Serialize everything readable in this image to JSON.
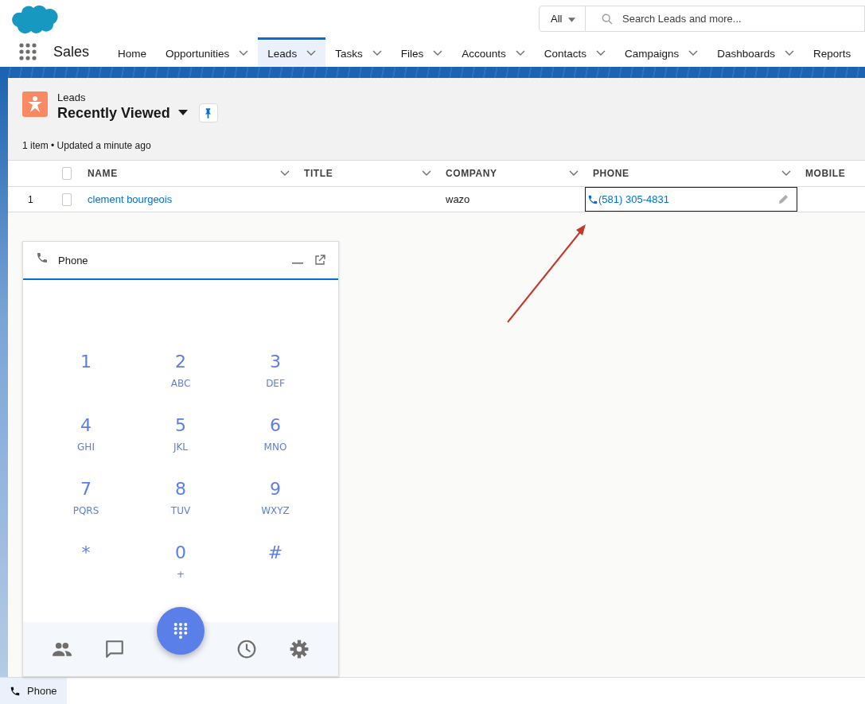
{
  "app": {
    "name": "Sales"
  },
  "search": {
    "scope": "All",
    "placeholder": "Search Leads and more..."
  },
  "nav": [
    {
      "label": "Home",
      "selected": false,
      "menu": false
    },
    {
      "label": "Opportunities",
      "selected": false,
      "menu": true
    },
    {
      "label": "Leads",
      "selected": true,
      "menu": true
    },
    {
      "label": "Tasks",
      "selected": false,
      "menu": true
    },
    {
      "label": "Files",
      "selected": false,
      "menu": true
    },
    {
      "label": "Accounts",
      "selected": false,
      "menu": true
    },
    {
      "label": "Contacts",
      "selected": false,
      "menu": true
    },
    {
      "label": "Campaigns",
      "selected": false,
      "menu": true
    },
    {
      "label": "Dashboards",
      "selected": false,
      "menu": true
    },
    {
      "label": "Reports",
      "selected": false,
      "menu": false
    }
  ],
  "list": {
    "object": "Leads",
    "view": "Recently Viewed",
    "status": "1 item • Updated a minute ago"
  },
  "table": {
    "all_checked": false,
    "columns": [
      {
        "label": "NAME",
        "menu": true
      },
      {
        "label": "TITLE",
        "menu": true
      },
      {
        "label": "COMPANY",
        "menu": true
      },
      {
        "label": "PHONE",
        "menu": true
      },
      {
        "label": "MOBILE"
      }
    ],
    "rows": [
      {
        "number": "1",
        "checked": false,
        "name": "clement bourgeois",
        "company": "wazo",
        "phone": "(581) 305-4831",
        "focused": true
      }
    ]
  },
  "phone_panel": {
    "title": "Phone",
    "keys": [
      {
        "digit": "1"
      },
      {
        "digit": "2",
        "letters": "ABC"
      },
      {
        "digit": "3",
        "letters": "DEF"
      },
      {
        "digit": "4",
        "letters": "GHI"
      },
      {
        "digit": "5",
        "letters": "JKL"
      },
      {
        "digit": "6",
        "letters": "MNO"
      },
      {
        "digit": "7",
        "letters": "PQRS"
      },
      {
        "digit": "8",
        "letters": "TUV"
      },
      {
        "digit": "9",
        "letters": "WXYZ"
      },
      {
        "digit": "*"
      },
      {
        "digit": "0",
        "letters": "+"
      },
      {
        "digit": "#"
      }
    ]
  },
  "utility_bar": {
    "items": [
      {
        "label": "Phone",
        "selected": true
      }
    ]
  }
}
